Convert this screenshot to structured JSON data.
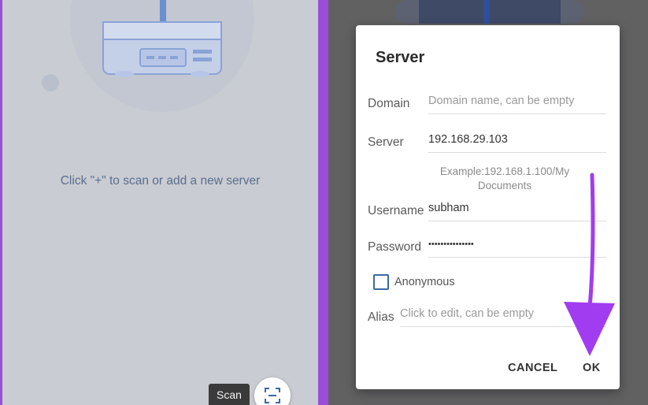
{
  "left_screen": {
    "empty_message": "Click \"+\" to scan or add a new server",
    "scan_tooltip": "Scan",
    "scan_button_icon": "scan-icon"
  },
  "dialog": {
    "title": "Server",
    "domain": {
      "label": "Domain",
      "value": "",
      "placeholder": "Domain name, can be empty"
    },
    "server": {
      "label": "Server",
      "value": "192.168.29.103",
      "hint": "Example:192.168.1.100/My Documents"
    },
    "username": {
      "label": "Username",
      "value": "subham"
    },
    "password": {
      "label": "Password",
      "value": "•••••••••••••••"
    },
    "anonymous": {
      "label": "Anonymous",
      "checked": false
    },
    "alias": {
      "label": "Alias",
      "value": "",
      "placeholder": "Click to edit, can be empty"
    },
    "cancel_label": "CANCEL",
    "ok_label": "OK"
  },
  "colors": {
    "frame": "#9a4fd6",
    "annotation_arrow": "#a23cf0",
    "checkbox_border": "#3b6aa0"
  }
}
